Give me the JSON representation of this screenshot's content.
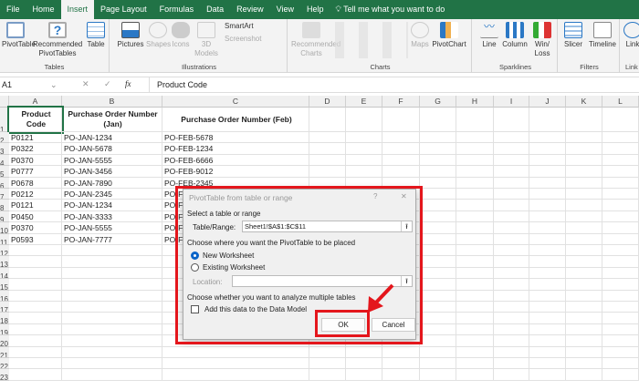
{
  "tabs": [
    "File",
    "Home",
    "Insert",
    "Page Layout",
    "Formulas",
    "Data",
    "Review",
    "View",
    "Help"
  ],
  "active_tab": "Insert",
  "tell_me": "Tell me what you want to do",
  "ribbon": {
    "groups": {
      "tables": "Tables",
      "illustrations": "Illustrations",
      "charts": "Charts",
      "sparklines": "Sparklines",
      "filters": "Filters",
      "links": "Link"
    },
    "pivottable": "PivotTable",
    "recommended_pivot": "Recommended PivotTables",
    "table": "Table",
    "pictures": "Pictures",
    "shapes": "Shapes",
    "icons": "Icons",
    "models3d": "3D Models",
    "smartart": "SmartArt",
    "screenshot": "Screenshot",
    "recommended_charts": "Recommended Charts",
    "maps": "Maps",
    "pivotchart": "PivotChart",
    "line": "Line",
    "column": "Column",
    "winloss": "Win/ Loss",
    "slicer": "Slicer",
    "timeline": "Timeline",
    "link": "Link"
  },
  "formula_bar": {
    "name_box": "A1",
    "fx": "fx",
    "content": "Product Code"
  },
  "columns": [
    "A",
    "B",
    "C",
    "D",
    "E",
    "F",
    "G",
    "H",
    "I",
    "J",
    "K",
    "L"
  ],
  "headers": [
    "Product Code",
    "Purchase Order Number (Jan)",
    "Purchase Order Number (Feb)"
  ],
  "rows": [
    [
      "P0121",
      "PO-JAN-1234",
      "PO-FEB-5678"
    ],
    [
      "P0322",
      "PO-JAN-5678",
      "PO-FEB-1234"
    ],
    [
      "P0370",
      "PO-JAN-5555",
      "PO-FEB-6666"
    ],
    [
      "P0777",
      "PO-JAN-3456",
      "PO-FEB-9012"
    ],
    [
      "P0678",
      "PO-JAN-7890",
      "PO-FEB-2345"
    ],
    [
      "P0212",
      "PO-JAN-2345",
      "PO-F"
    ],
    [
      "P0121",
      "PO-JAN-1234",
      "PO-F"
    ],
    [
      "P0450",
      "PO-JAN-3333",
      "PO-F"
    ],
    [
      "P0370",
      "PO-JAN-5555",
      "PO-F"
    ],
    [
      "P0593",
      "PO-JAN-7777",
      "PO-F"
    ]
  ],
  "dialog": {
    "title": "PivotTable from table or range",
    "help": "?",
    "close": "✕",
    "select_label": "Select a table or range",
    "range_label": "Table/Range:",
    "range_value": "Sheet1!$A$1:$C$11",
    "place_label": "Choose where you want the PivotTable to be placed",
    "new_ws": "New Worksheet",
    "existing_ws": "Existing Worksheet",
    "location_label": "Location:",
    "location_value": "",
    "multi_label": "Choose whether you want to analyze multiple tables",
    "data_model": "Add this data to the Data Model",
    "data_model_checked": false,
    "selected_option": "New Worksheet",
    "ok": "OK",
    "cancel": "Cancel"
  },
  "colors": {
    "excel_green": "#217346",
    "highlight_red": "#e4161c",
    "radio_blue": "#0a64c8"
  }
}
